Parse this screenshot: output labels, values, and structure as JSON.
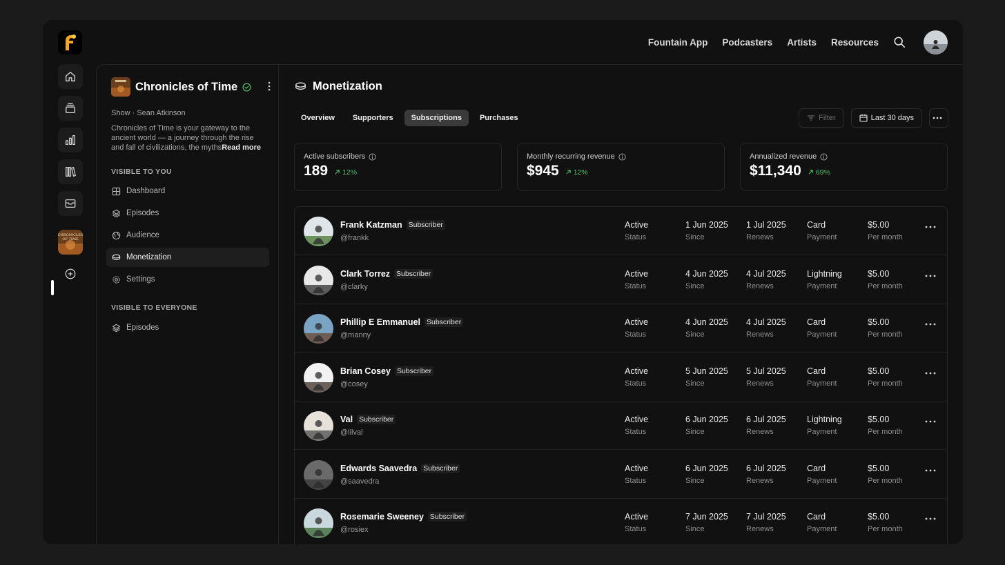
{
  "topnav": {
    "links": [
      "Fountain App",
      "Podcasters",
      "Artists",
      "Resources"
    ]
  },
  "show": {
    "title": "Chronicles of Time",
    "meta": "Show · Sean Atkinson",
    "description": "Chronicles of Time is your gateway to the ancient world — a journey through the rise and fall of civilizations, the myths",
    "read_more": "Read more"
  },
  "sidebar": {
    "section_private": "VISIBLE TO YOU",
    "private_items": [
      "Dashboard",
      "Episodes",
      "Audience",
      "Monetization",
      "Settings"
    ],
    "section_public": "VISIBLE TO EVERYONE",
    "public_items": [
      "Episodes"
    ]
  },
  "page": {
    "title": "Monetization",
    "tabs": [
      "Overview",
      "Supporters",
      "Subscriptions",
      "Purchases"
    ],
    "active_tab": "Subscriptions",
    "filter_label": "Filter",
    "date_range": "Last 30 days"
  },
  "stats": [
    {
      "label": "Active subscribers",
      "value": "189",
      "change": "12%"
    },
    {
      "label": "Monthly recurring revenue",
      "value": "$945",
      "change": "12%"
    },
    {
      "label": "Annualized revenue",
      "value": "$11,340",
      "change": "69%"
    }
  ],
  "columns": {
    "status": "Status",
    "since": "Since",
    "renews": "Renews",
    "payment": "Payment",
    "amount": "Per month"
  },
  "subscribers": [
    {
      "name": "Frank Katzman",
      "badge": "Subscriber",
      "handle": "@frankk",
      "status": "Active",
      "since": "1 Jun 2025",
      "renews": "1 Jul 2025",
      "payment": "Card",
      "amount": "$5.00"
    },
    {
      "name": "Clark Torrez",
      "badge": "Subscriber",
      "handle": "@clarky",
      "status": "Active",
      "since": "4 Jun 2025",
      "renews": "4 Jul 2025",
      "payment": "Lightning",
      "amount": "$5.00"
    },
    {
      "name": "Phillip E Emmanuel",
      "badge": "Subscriber",
      "handle": "@manny",
      "status": "Active",
      "since": "4 Jun 2025",
      "renews": "4 Jul 2025",
      "payment": "Card",
      "amount": "$5.00"
    },
    {
      "name": "Brian Cosey",
      "badge": "Subscriber",
      "handle": "@cosey",
      "status": "Active",
      "since": "5 Jun 2025",
      "renews": "5 Jul 2025",
      "payment": "Card",
      "amount": "$5.00"
    },
    {
      "name": "Val",
      "badge": "Subscriber",
      "handle": "@lilval",
      "status": "Active",
      "since": "6 Jun 2025",
      "renews": "6 Jul 2025",
      "payment": "Lightning",
      "amount": "$5.00"
    },
    {
      "name": "Edwards Saavedra",
      "badge": "Subscriber",
      "handle": "@saavedra",
      "status": "Active",
      "since": "6 Jun 2025",
      "renews": "6 Jul 2025",
      "payment": "Card",
      "amount": "$5.00"
    },
    {
      "name": "Rosemarie Sweeney",
      "badge": "Subscriber",
      "handle": "@rosiex",
      "status": "Active",
      "since": "7 Jun 2025",
      "renews": "7 Jul 2025",
      "payment": "Card",
      "amount": "$5.00"
    }
  ],
  "colors": {
    "accent_green": "#4cc26a",
    "logo_orange": "#f5a623",
    "background": "#111111"
  },
  "icons": {
    "rail": [
      "home-icon",
      "layers-icon",
      "bar-chart-icon",
      "library-icon",
      "inbox-icon",
      "plus-circle-icon"
    ]
  }
}
